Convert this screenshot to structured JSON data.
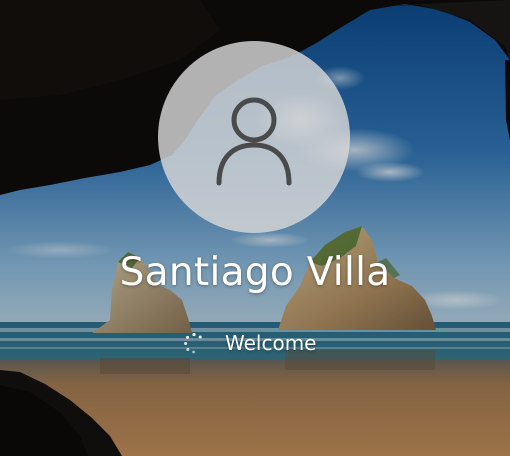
{
  "colors": {
    "avatar_bg": "#d8d8d8",
    "avatar_glyph": "#4a4a4a",
    "text": "#ffffff",
    "sky_top": "#0f4e8f",
    "sky_bottom": "#7fb2d8",
    "sand": "#b88a5a"
  },
  "login": {
    "avatar_icon": "user-silhouette-icon",
    "user_name": "Santiago Villa",
    "status": "Welcome",
    "spinner_icon": "loading-spinner-icon"
  }
}
